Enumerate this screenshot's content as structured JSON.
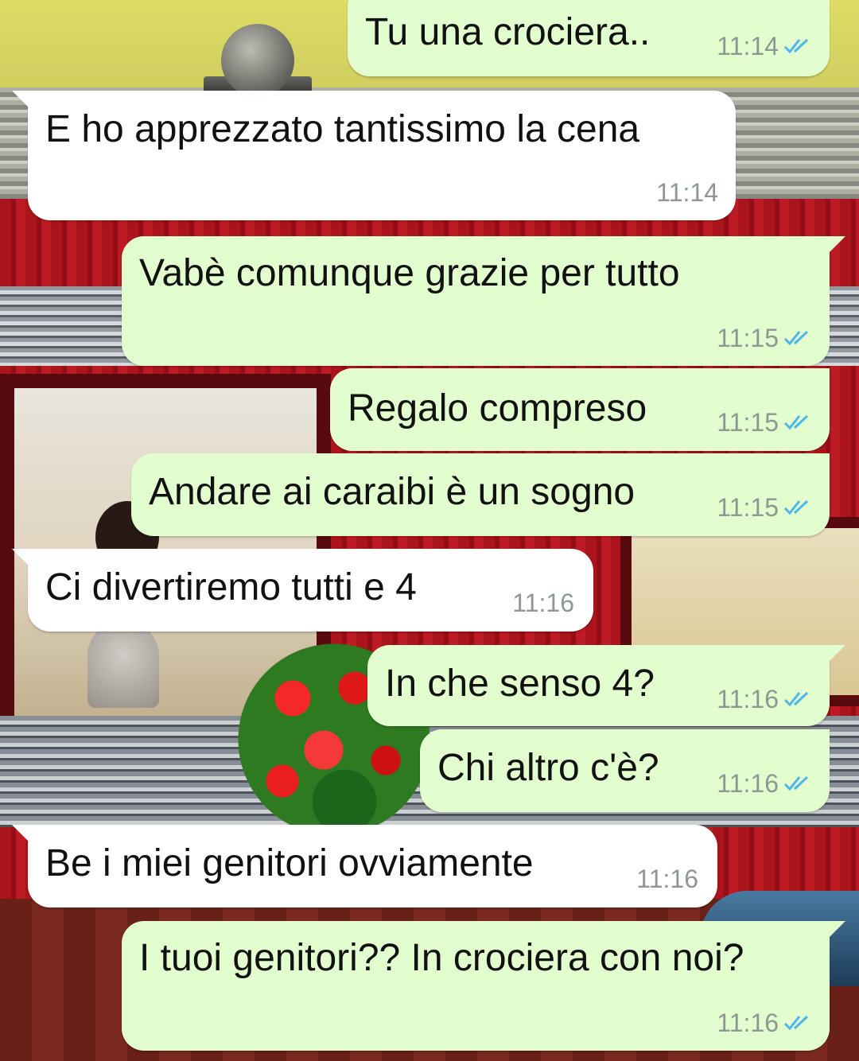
{
  "colors": {
    "outgoing_bubble": "#e2fecf",
    "incoming_bubble": "#ffffff",
    "read_ticks": "#4fb6ec",
    "timestamp": "#8e9892"
  },
  "messages": [
    {
      "direction": "out",
      "text": "Tu una crociera..",
      "time": "11:14",
      "status_icon": "double-check-read-icon"
    },
    {
      "direction": "in",
      "text": "E ho apprezzato tantissimo la cena",
      "time": "11:14"
    },
    {
      "direction": "out",
      "text": "Vabè comunque grazie per tutto",
      "time": "11:15",
      "status_icon": "double-check-read-icon"
    },
    {
      "direction": "out",
      "text": "Regalo compreso",
      "time": "11:15",
      "status_icon": "double-check-read-icon"
    },
    {
      "direction": "out",
      "text": "Andare ai caraibi è un sogno",
      "time": "11:15",
      "status_icon": "double-check-read-icon"
    },
    {
      "direction": "in",
      "text": "Ci divertiremo tutti e 4",
      "time": "11:16"
    },
    {
      "direction": "out",
      "text": "In che senso 4?",
      "time": "11:16",
      "status_icon": "double-check-read-icon"
    },
    {
      "direction": "out",
      "text": "Chi altro c'è?",
      "time": "11:16",
      "status_icon": "double-check-read-icon"
    },
    {
      "direction": "in",
      "text": "Be i miei genitori ovviamente",
      "time": "11:16"
    },
    {
      "direction": "out",
      "text": "I tuoi genitori?? In crociera con noi?",
      "time": "11:16",
      "status_icon": "double-check-read-icon"
    }
  ]
}
